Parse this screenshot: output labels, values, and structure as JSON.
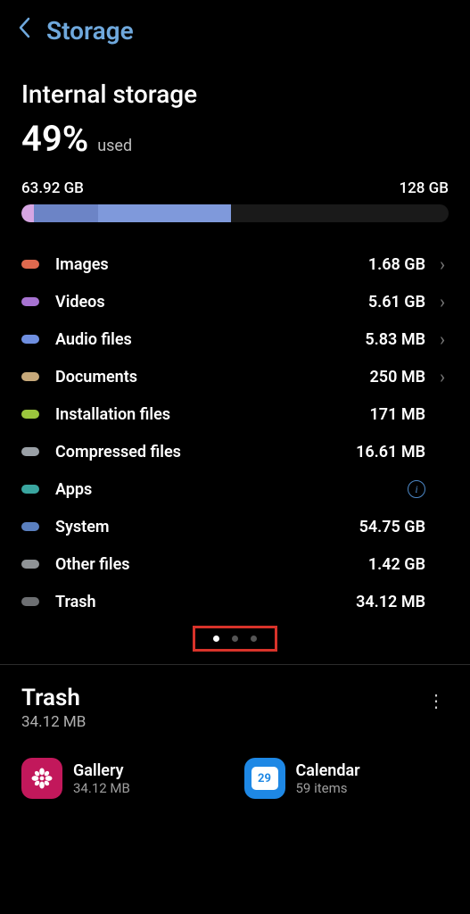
{
  "header": {
    "title": "Storage"
  },
  "overview": {
    "title": "Internal storage",
    "percent": "49%",
    "percent_label": "used",
    "used_label": "63.92 GB",
    "total_label": "128 GB"
  },
  "segments": [
    {
      "color": "#d7a6e3",
      "width": 3
    },
    {
      "color": "#6c84c6",
      "width": 15
    },
    {
      "color": "#7f99db",
      "width": 31
    }
  ],
  "categories": [
    {
      "color": "#e0694e",
      "label": "Images",
      "value": "1.68 GB",
      "chevron": true,
      "info": false
    },
    {
      "color": "#a773d1",
      "label": "Videos",
      "value": "5.61 GB",
      "chevron": true,
      "info": false
    },
    {
      "color": "#6f8fe0",
      "label": "Audio files",
      "value": "5.83 MB",
      "chevron": true,
      "info": false
    },
    {
      "color": "#c7a97a",
      "label": "Documents",
      "value": "250 MB",
      "chevron": true,
      "info": false
    },
    {
      "color": "#9bc53d",
      "label": "Installation files",
      "value": "171 MB",
      "chevron": false,
      "info": false
    },
    {
      "color": "#9aa0a6",
      "label": "Compressed files",
      "value": "16.61 MB",
      "chevron": false,
      "info": false
    },
    {
      "color": "#3aa6a0",
      "label": "Apps",
      "value": "",
      "chevron": false,
      "info": true
    },
    {
      "color": "#5a7fbf",
      "label": "System",
      "value": "54.75 GB",
      "chevron": false,
      "info": false
    },
    {
      "color": "#8f9396",
      "label": "Other files",
      "value": "1.42 GB",
      "chevron": false,
      "info": false
    },
    {
      "color": "#6d6f72",
      "label": "Trash",
      "value": "34.12 MB",
      "chevron": false,
      "info": false
    }
  ],
  "pager": {
    "count": 3,
    "active": 0
  },
  "trash": {
    "title": "Trash",
    "subtitle": "34.12 MB",
    "items": [
      {
        "kind": "gallery",
        "label": "Gallery",
        "sub": "34.12 MB",
        "day": ""
      },
      {
        "kind": "calendar",
        "label": "Calendar",
        "sub": "59 items",
        "day": "29"
      }
    ]
  }
}
